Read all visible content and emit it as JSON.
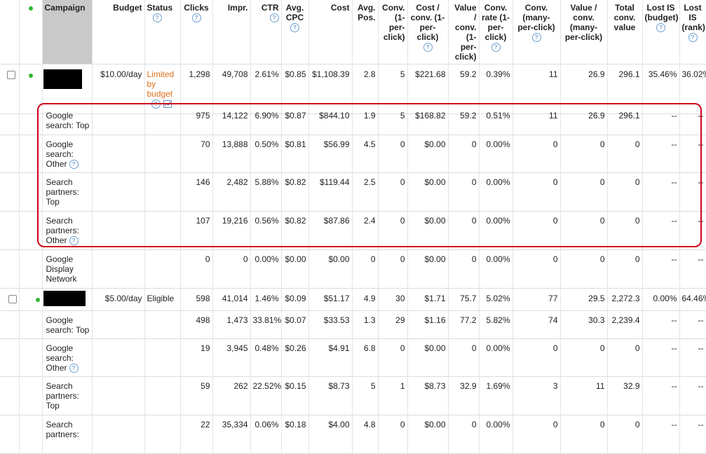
{
  "columns": {
    "campaign": "Campaign",
    "budget": "Budget",
    "status": "Status",
    "clicks": "Clicks",
    "impr": "Impr.",
    "ctr": "CTR",
    "avg_cpc": "Avg. CPC",
    "cost": "Cost",
    "avg_pos": "Avg. Pos.",
    "conv1": "Conv. (1-per-click)",
    "cost_conv1": "Cost / conv. (1-per-click)",
    "value_conv1": "Value / conv. (1-per-click)",
    "conv_rate": "Conv. rate (1-per-click)",
    "conv_many": "Conv. (many-per-click)",
    "value_conv_many": "Value / conv. (many-per-click)",
    "total_conv_value": "Total conv. value",
    "lost_budget": "Lost IS (budget)",
    "lost_rank": "Lost IS (rank)"
  },
  "help_glyph": "?",
  "campaign1": {
    "budget": "$10.00/day",
    "status": "Limited by budget",
    "clicks": "1,298",
    "impr": "49,708",
    "ctr": "2.61%",
    "cpc": "$0.85",
    "cost": "$1,108.39",
    "pos": "2.8",
    "conv1": "5",
    "cost_conv1": "$221.68",
    "val_conv1": "59.2",
    "rate": "0.39%",
    "conv_many": "11",
    "val_many": "26.9",
    "total": "296.1",
    "lost_b": "35.46%",
    "lost_r": "36.02%",
    "rows": [
      {
        "label": "Google search: Top",
        "clicks": "975",
        "impr": "14,122",
        "ctr": "6.90%",
        "cpc": "$0.87",
        "cost": "$844.10",
        "pos": "1.9",
        "conv1": "5",
        "cost_conv1": "$168.82",
        "val_conv1": "59.2",
        "rate": "0.51%",
        "conv_many": "11",
        "val_many": "26.9",
        "total": "296.1",
        "lost_b": "--",
        "lost_r": "--"
      },
      {
        "label": "Google search: Other",
        "clicks": "70",
        "impr": "13,888",
        "ctr": "0.50%",
        "cpc": "$0.81",
        "cost": "$56.99",
        "pos": "4.5",
        "conv1": "0",
        "cost_conv1": "$0.00",
        "val_conv1": "0",
        "rate": "0.00%",
        "conv_many": "0",
        "val_many": "0",
        "total": "0",
        "lost_b": "--",
        "lost_r": "--"
      },
      {
        "label": "Search partners: Top",
        "clicks": "146",
        "impr": "2,482",
        "ctr": "5.88%",
        "cpc": "$0.82",
        "cost": "$119.44",
        "pos": "2.5",
        "conv1": "0",
        "cost_conv1": "$0.00",
        "val_conv1": "0",
        "rate": "0.00%",
        "conv_many": "0",
        "val_many": "0",
        "total": "0",
        "lost_b": "--",
        "lost_r": "--"
      },
      {
        "label": "Search partners: Other",
        "clicks": "107",
        "impr": "19,216",
        "ctr": "0.56%",
        "cpc": "$0.82",
        "cost": "$87.86",
        "pos": "2.4",
        "conv1": "0",
        "cost_conv1": "$0.00",
        "val_conv1": "0",
        "rate": "0.00%",
        "conv_many": "0",
        "val_many": "0",
        "total": "0",
        "lost_b": "--",
        "lost_r": "--"
      },
      {
        "label": "Google Display Network",
        "clicks": "0",
        "impr": "0",
        "ctr": "0.00%",
        "cpc": "$0.00",
        "cost": "$0.00",
        "pos": "0",
        "conv1": "0",
        "cost_conv1": "$0.00",
        "val_conv1": "0",
        "rate": "0.00%",
        "conv_many": "0",
        "val_many": "0",
        "total": "0",
        "lost_b": "--",
        "lost_r": "--"
      }
    ]
  },
  "campaign2": {
    "budget": "$5.00/day",
    "status": "Eligible",
    "clicks": "598",
    "impr": "41,014",
    "ctr": "1.46%",
    "cpc": "$0.09",
    "cost": "$51.17",
    "pos": "4.9",
    "conv1": "30",
    "cost_conv1": "$1.71",
    "val_conv1": "75.7",
    "rate": "5.02%",
    "conv_many": "77",
    "val_many": "29.5",
    "total": "2,272.3",
    "lost_b": "0.00%",
    "lost_r": "64.46%",
    "rows": [
      {
        "label": "Google search: Top",
        "clicks": "498",
        "impr": "1,473",
        "ctr": "33.81%",
        "cpc": "$0.07",
        "cost": "$33.53",
        "pos": "1.3",
        "conv1": "29",
        "cost_conv1": "$1.16",
        "val_conv1": "77.2",
        "rate": "5.82%",
        "conv_many": "74",
        "val_many": "30.3",
        "total": "2,239.4",
        "lost_b": "--",
        "lost_r": "--"
      },
      {
        "label": "Google search: Other",
        "clicks": "19",
        "impr": "3,945",
        "ctr": "0.48%",
        "cpc": "$0.26",
        "cost": "$4.91",
        "pos": "6.8",
        "conv1": "0",
        "cost_conv1": "$0.00",
        "val_conv1": "0",
        "rate": "0.00%",
        "conv_many": "0",
        "val_many": "0",
        "total": "0",
        "lost_b": "--",
        "lost_r": "--"
      },
      {
        "label": "Search partners: Top",
        "clicks": "59",
        "impr": "262",
        "ctr": "22.52%",
        "cpc": "$0.15",
        "cost": "$8.73",
        "pos": "5",
        "conv1": "1",
        "cost_conv1": "$8.73",
        "val_conv1": "32.9",
        "rate": "1.69%",
        "conv_many": "3",
        "val_many": "11",
        "total": "32.9",
        "lost_b": "--",
        "lost_r": "--"
      },
      {
        "label": "Search partners:",
        "clicks": "22",
        "impr": "35,334",
        "ctr": "0.06%",
        "cpc": "$0.18",
        "cost": "$4.00",
        "pos": "4.8",
        "conv1": "0",
        "cost_conv1": "$0.00",
        "val_conv1": "0",
        "rate": "0.00%",
        "conv_many": "0",
        "val_many": "0",
        "total": "0",
        "lost_b": "--",
        "lost_r": "--"
      }
    ]
  }
}
